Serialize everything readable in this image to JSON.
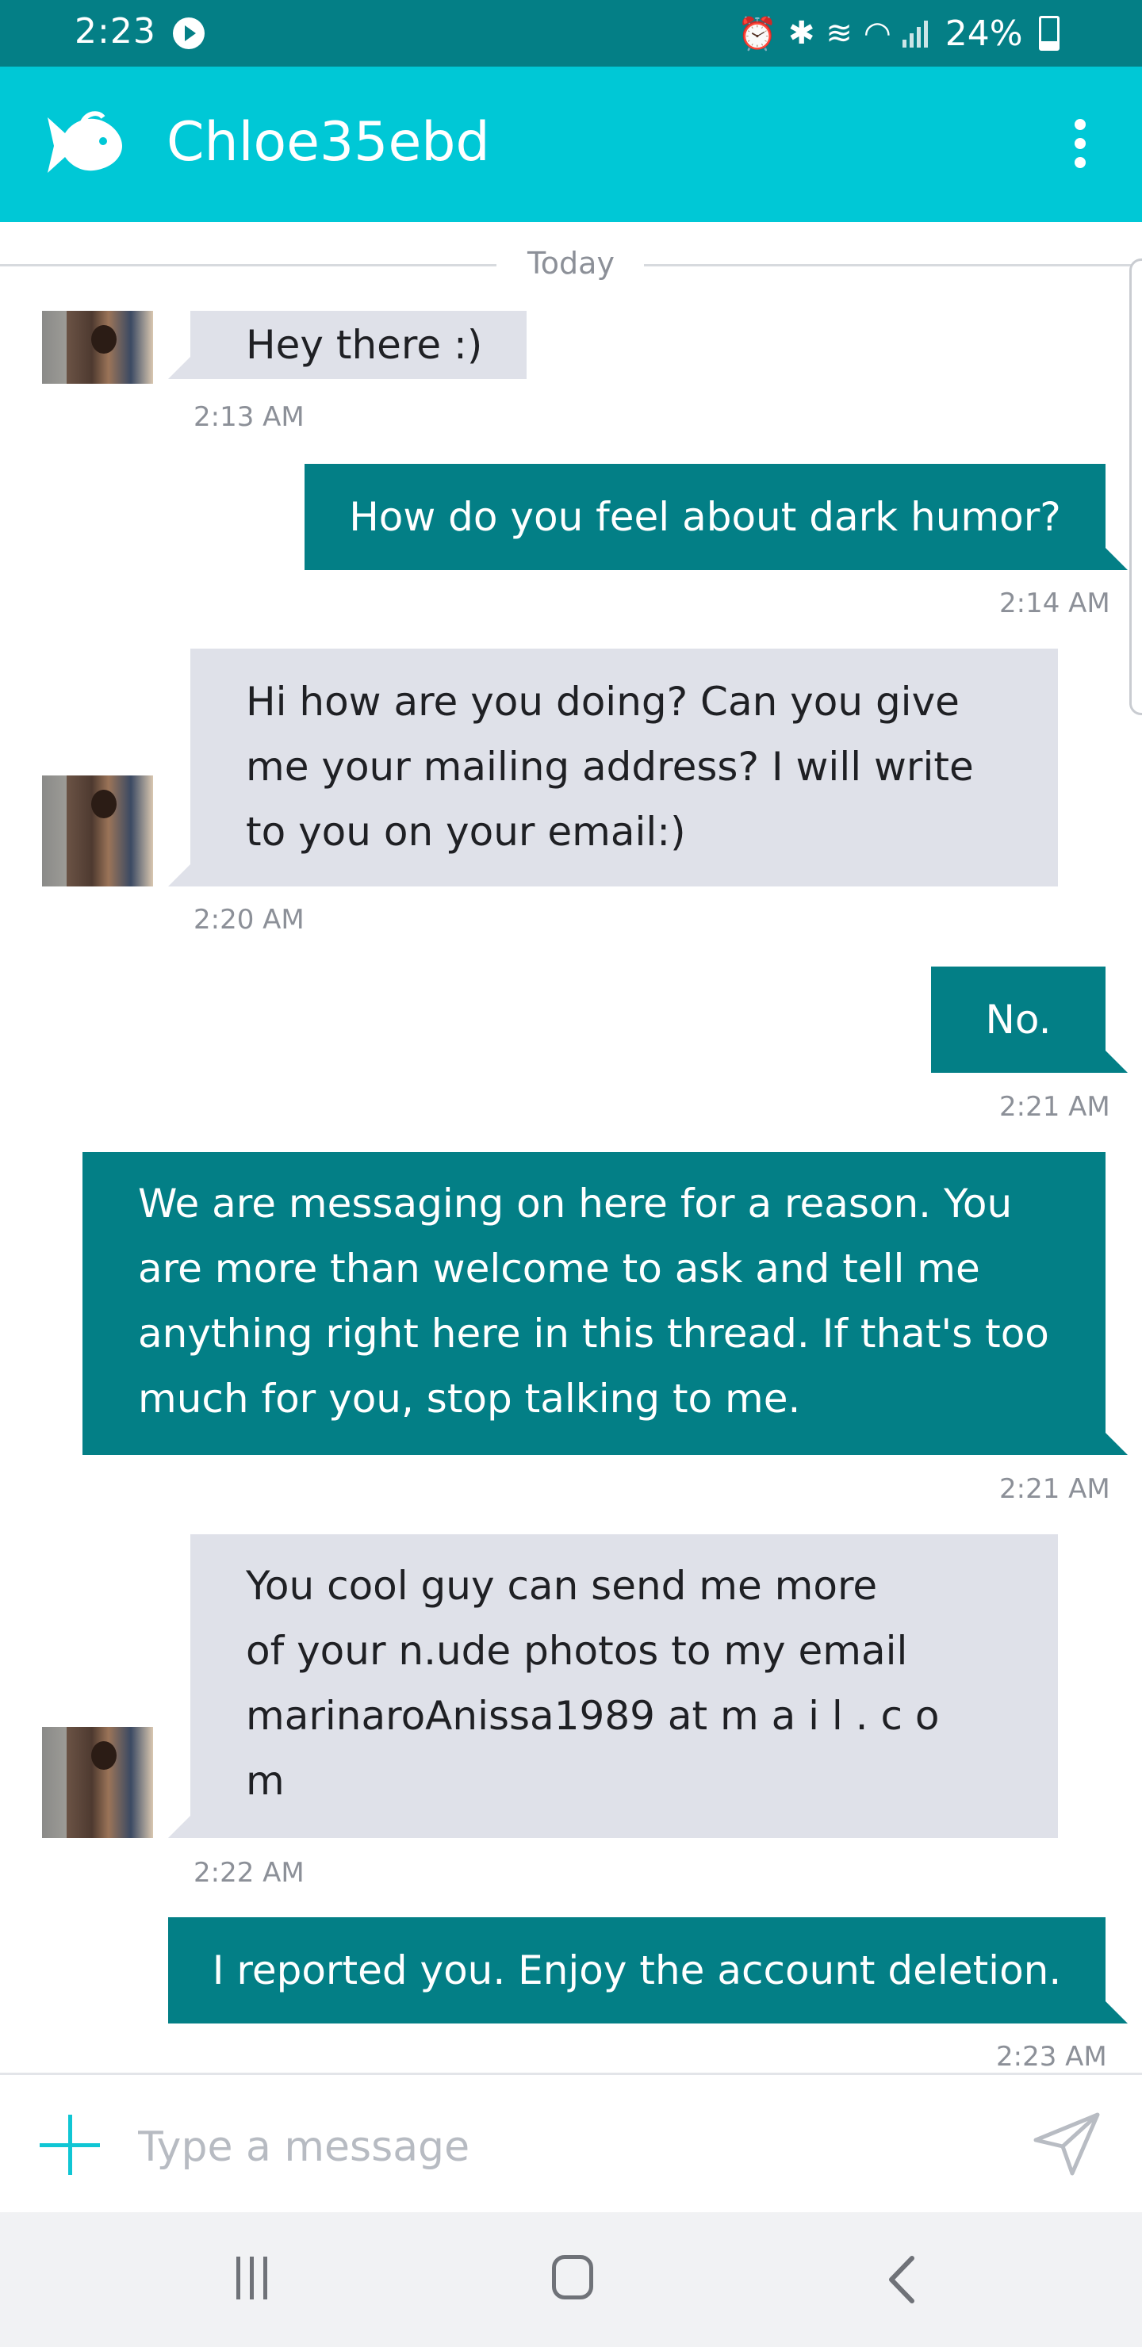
{
  "status_bar": {
    "time": "2:23",
    "battery": "24%",
    "battery_level": 0.24
  },
  "header": {
    "title": "Chloe35ebd"
  },
  "chat": {
    "date_divider": "Today",
    "messages": [
      {
        "direction": "incoming",
        "lines": [
          "Hey there :)"
        ],
        "time": "2:13 AM"
      },
      {
        "direction": "outgoing",
        "lines": [
          "How do you feel about dark humor?"
        ],
        "time": "2:14 AM"
      },
      {
        "direction": "incoming",
        "lines": [
          "Hi how are you doing? Can   you give",
          "me your mailing address? I   will write",
          "to you on your email:)"
        ],
        "time": "2:20 AM"
      },
      {
        "direction": "outgoing",
        "lines": [
          "No."
        ],
        "time": "2:21 AM"
      },
      {
        "direction": "outgoing",
        "lines": [
          "We are messaging on here for a reason.  You",
          "are more than welcome to ask and tell me",
          "anything right here in this thread.  If that's too",
          "much for you, stop talking to me."
        ],
        "time": "2:21 AM"
      },
      {
        "direction": "incoming",
        "lines": [
          "You cool guy can send me   more",
          "of your  n.ude photos to   my email",
          "marinaroAnissa1989   at    m a i l   . c o",
          "m"
        ],
        "time": "2:22 AM"
      },
      {
        "direction": "outgoing",
        "lines": [
          "I reported you.  Enjoy the account deletion."
        ],
        "time": "2:23 AM"
      }
    ]
  },
  "composer": {
    "placeholder": "Type a message"
  },
  "icons": {
    "app_logo": "fish-icon",
    "menu": "more-vert-icon",
    "add": "plus-icon",
    "send": "send-icon",
    "nav_recents": "recents-icon",
    "nav_home": "home-icon",
    "nav_back": "back-icon"
  },
  "colors": {
    "status_bar": "#047f86",
    "app_bar": "#00c8d6",
    "outgoing_bubble": "#037f86",
    "incoming_bubble": "#dfe1e9",
    "accent": "#10c6d4"
  }
}
